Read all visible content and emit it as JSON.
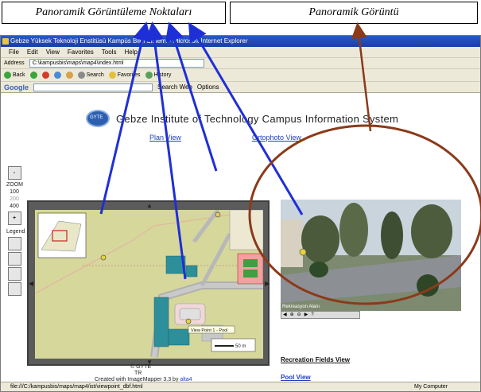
{
  "callouts": {
    "left": "Panoramik Görüntüleme Noktaları",
    "right": "Panoramik Görüntü"
  },
  "window": {
    "title": "Gebze Yüksek Teknoloji Enstitüsü Kampüs Bilgi Sistemi - Microsoft Internet Explorer",
    "menu": [
      "File",
      "Edit",
      "View",
      "Favorites",
      "Tools",
      "Help"
    ],
    "address_label": "Address",
    "address_value": "C:\\kampusbis\\maps\\map4\\index.html",
    "toolbar": {
      "back": "Back",
      "search": "Search",
      "favorites": "Favorites",
      "history": "History"
    },
    "google": {
      "logo": "Google",
      "search_web": "Search Web",
      "options": "Options"
    },
    "status_text": "file:///C:/kampusbis/maps/map4/ist/viewpoint_dbf.html",
    "status_zone": "My Computer"
  },
  "page": {
    "site_title": "Gebze Institute of Technology Campus Information System",
    "logo_text": "GYTE",
    "links": {
      "plan": "Plan View",
      "ortho": "Ortophoto View",
      "recreation": "Recreation Fields View",
      "pool": "Pool View"
    },
    "zoom": {
      "label": "ZOOM",
      "levels": [
        "100",
        "200",
        "400"
      ],
      "plus": "+",
      "minus": "-"
    },
    "tools": {
      "legend": "Legend",
      "overview": "Overview"
    },
    "map": {
      "tooltip": "View Point 1 - Pool",
      "scale": "50 m"
    },
    "pano": {
      "caption": "Rekreasyon Alanı",
      "controls": [
        "◀",
        "⊕",
        "⊖",
        "▶",
        "?"
      ]
    },
    "footer": {
      "copyright": "© GYTE",
      "country": "TR",
      "created_prefix": "Created with ImageMapper 3.3 by ",
      "created_brand": "alta4"
    }
  },
  "colors": {
    "callout_arrows": "#1f2fd6",
    "pano_arrow": "#8b3a1a",
    "buildings": "#2c8f9a",
    "viewpoint": "#e6d23a"
  }
}
